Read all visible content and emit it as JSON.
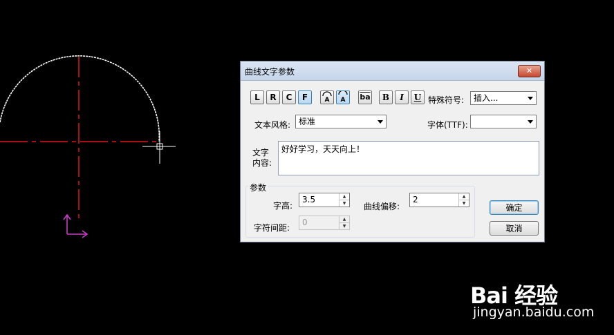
{
  "dialog": {
    "title": "曲线文字参数",
    "close_label": "✕",
    "toolbar": {
      "align_left": "L",
      "align_right": "R",
      "align_center": "C",
      "align_fit": "F",
      "bold": "B",
      "italic": "I",
      "underline": "U",
      "ba_icon": "ba"
    },
    "special_symbol": {
      "label": "特殊符号:",
      "value": "插入..."
    },
    "text_style": {
      "label": "文本风格:",
      "value": "标准"
    },
    "font_ttf": {
      "label": "字体(TTF):",
      "value": ""
    },
    "text_content": {
      "label_line1": "文字",
      "label_line2": "内容:",
      "value": "好好学习，天天向上！"
    },
    "params": {
      "group_label": "参数",
      "char_height_label": "字高:",
      "char_height_value": "3.5",
      "curve_offset_label": "曲线偏移:",
      "curve_offset_value": "2",
      "char_spacing_label": "字符间距:",
      "char_spacing_value": "0"
    },
    "ok_label": "确定",
    "cancel_label": "取消"
  },
  "watermark": {
    "brand": "Bai 经验",
    "url": "jingyan.baidu.com"
  },
  "colors": {
    "cad_background": "#000000",
    "arc": "#ffffff",
    "centerline": "#e0141e",
    "ucs": "#c83cc8",
    "arrow": "#e8231f"
  }
}
